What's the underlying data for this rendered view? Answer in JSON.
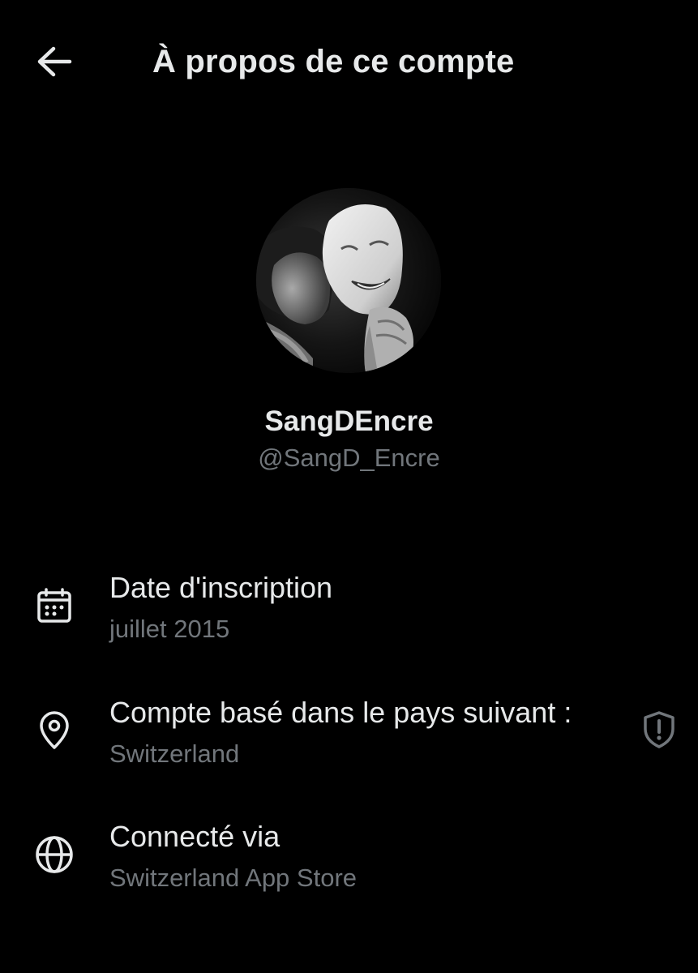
{
  "header": {
    "title": "À propos de ce compte",
    "back_icon": "arrow-left-icon"
  },
  "profile": {
    "display_name": "SangDEncre",
    "handle": "@SangD_Encre",
    "avatar": "black-and-white photo of a person holding a smiling mask"
  },
  "details": [
    {
      "icon": "calendar-icon",
      "label": "Date d'inscription",
      "value": "juillet 2015"
    },
    {
      "icon": "location-pin-icon",
      "label": "Compte basé dans le pays suivant :",
      "value": "Switzerland",
      "action_icon": "shield-alert-icon"
    },
    {
      "icon": "globe-icon",
      "label": "Connecté via",
      "value": "Switzerland App Store"
    }
  ],
  "colors": {
    "background": "#000000",
    "primary_text": "#e7e9ea",
    "secondary_text": "#71767b"
  }
}
